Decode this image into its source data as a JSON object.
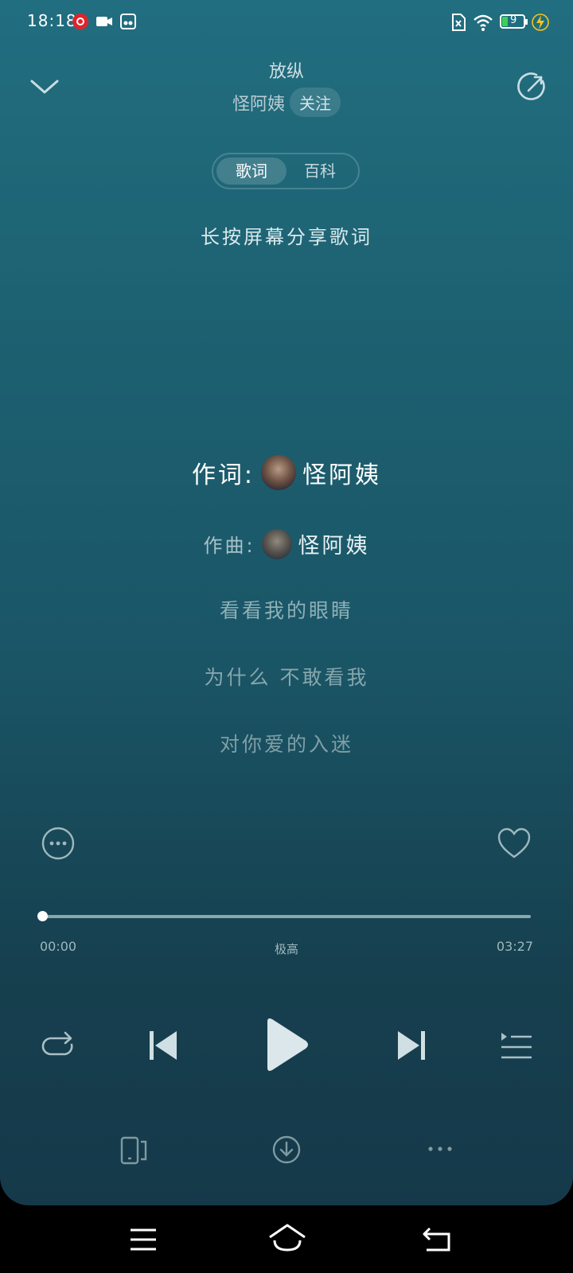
{
  "status_bar": {
    "time": "18:18",
    "battery_level": "9"
  },
  "header": {
    "song_title": "放纵",
    "artist": "怪阿姨",
    "follow_label": "关注"
  },
  "tabs": [
    {
      "label": "歌词",
      "active": true
    },
    {
      "label": "百科",
      "active": false
    }
  ],
  "lyrics": {
    "share_hint": "长按屏幕分享歌词",
    "lyricist_label": "作词:",
    "lyricist_name": "怪阿姨",
    "composer_label": "作曲:",
    "composer_name": "怪阿姨",
    "lines": [
      "看看我的眼睛",
      "为什么 不敢看我",
      "对你爱的入迷"
    ]
  },
  "player": {
    "current_time": "00:00",
    "total_time": "03:27",
    "quality": "极高",
    "progress": 0
  },
  "icons": {
    "colors": {
      "accent": "#ffffff",
      "muted": "#9fb8be",
      "charging": "#f5c518",
      "battery": "#3ecf5a"
    }
  }
}
